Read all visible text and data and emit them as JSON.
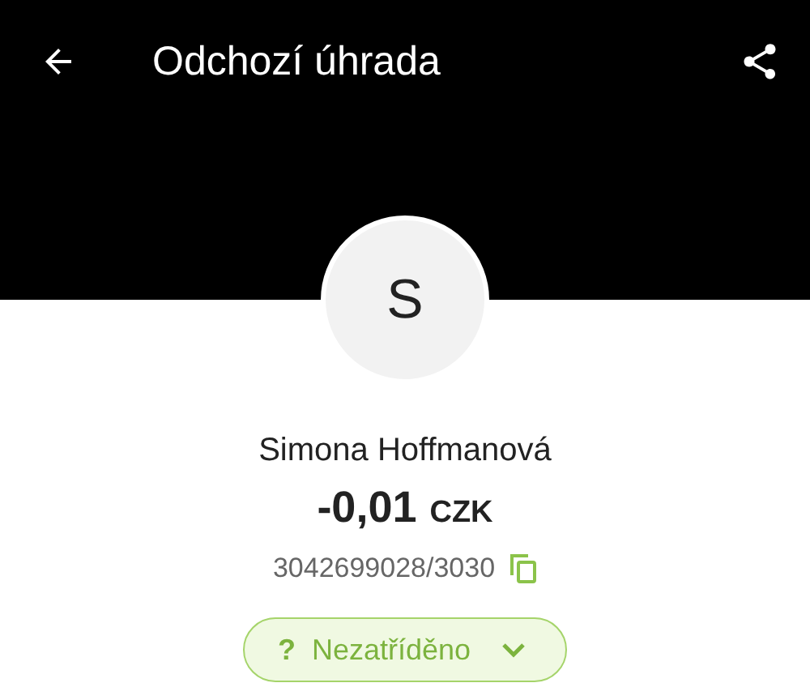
{
  "app_bar": {
    "title": "Odchozí úhrada"
  },
  "contact": {
    "initial": "S",
    "name": "Simona Hoffmanová",
    "amount": "-0,01",
    "currency": "CZK",
    "account": "3042699028/3030"
  },
  "category": {
    "icon": "?",
    "label": "Nezatříděno"
  }
}
